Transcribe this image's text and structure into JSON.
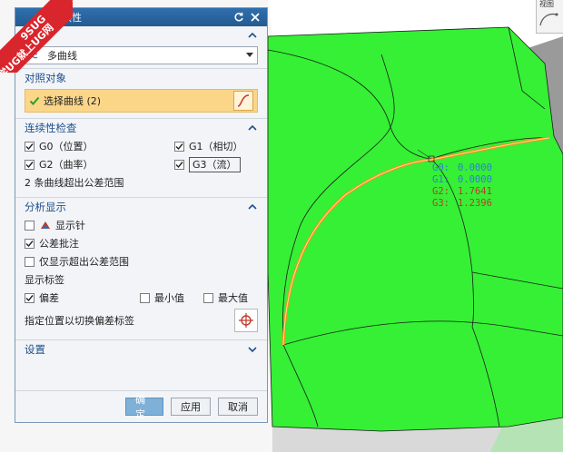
{
  "watermark": {
    "line1": "9SUG",
    "line2": "学UG就上UG网"
  },
  "dialog": {
    "title": "连续性",
    "type_section": {
      "title": "类型",
      "selected": "多曲线"
    },
    "compare_section": {
      "title": "对照对象",
      "select_label": "选择曲线 (2)"
    },
    "check_section": {
      "title": "连续性检查",
      "g0": "G0（位置）",
      "g1": "G1（相切）",
      "g2": "G2（曲率）",
      "g3": "G3（流）",
      "status": "2 条曲线超出公差范围"
    },
    "display_section": {
      "title": "分析显示",
      "show_needles": "显示针",
      "tolerance_note": "公差批注",
      "only_out_of_tol": "仅显示超出公差范围",
      "show_labels": "显示标签",
      "deviation": "偏差",
      "min_value": "最小值",
      "max_value": "最大值",
      "hint": "指定位置以切换偏差标签"
    },
    "settings_section": {
      "title": "设置"
    },
    "buttons": {
      "ok": "确定",
      "apply": "应用",
      "cancel": "取消"
    }
  },
  "readout": [
    {
      "key": "G0:",
      "value": "0.0000",
      "color": "#2f7fd0"
    },
    {
      "key": "G1:",
      "value": "0.0000",
      "color": "#2f7fd0"
    },
    {
      "key": "G2:",
      "value": "1.7641",
      "color": "#c0392b"
    },
    {
      "key": "G3:",
      "value": "1.2396",
      "color": "#c0392b"
    }
  ],
  "top_right_widget": {
    "label": "视图"
  },
  "colors": {
    "surface": "#33f033",
    "accent": "#2f6fae",
    "highlight": "#fbd689",
    "curve": "#ff8c1a"
  },
  "icons": [
    "multi-curve-icon",
    "check-icon",
    "curve-select-icon",
    "chevron-up-icon",
    "chevron-down-icon",
    "reset-icon",
    "close-icon",
    "needle-icon",
    "target-icon"
  ]
}
